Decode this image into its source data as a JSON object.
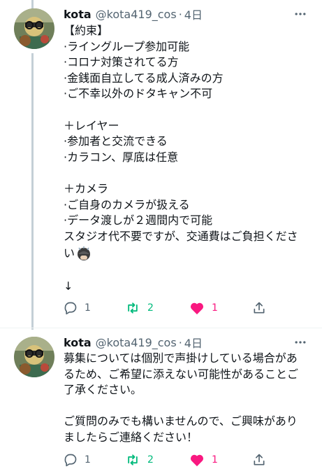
{
  "theme": {
    "text": "#0f1419",
    "muted": "#536471",
    "retweet_green": "#00ba7c",
    "like_pink": "#f91880",
    "thread_line": "#c4cfd6"
  },
  "tweets": [
    {
      "name": "kota",
      "handle": "@kota419_cos",
      "separator": "·",
      "time": "4日",
      "lines": [
        "【約束】",
        "·ライングループ参加可能",
        "·コロナ対策されてる方",
        "·金銭面自立してる成人済みの方",
        "·ご不幸以外のドタキャン不可",
        "",
        "＋レイヤー",
        "·参加者と交流できる",
        "·カラコン、厚底は任意",
        "",
        "＋カメラ",
        "·ご自身のカメラが扱える",
        "·データ渡しが２週間内で可能",
        "スタジオ代不要ですが、交通費はご負担くださ",
        "い",
        "",
        "↓"
      ],
      "emoji_icon": "sweating-face-emoji",
      "reply_count": "1",
      "retweet_count": "2",
      "like_count": "1",
      "liked": true,
      "icons": [
        "more-icon",
        "reply-icon",
        "retweet-icon",
        "like-icon",
        "share-icon"
      ]
    },
    {
      "name": "kota",
      "handle": "@kota419_cos",
      "separator": "·",
      "time": "4日",
      "lines": [
        "募集については個別で声掛けしている場合があ",
        "るため、ご希望に添えない可能性があることご",
        "了承ください。",
        "",
        "ご質問のみでも構いませんので、ご興味があり",
        "ましたらご連絡ください！"
      ],
      "reply_count": "1",
      "retweet_count": "2",
      "like_count": "1",
      "liked": true,
      "icons": [
        "more-icon",
        "reply-icon",
        "retweet-icon",
        "like-icon",
        "share-icon"
      ]
    }
  ]
}
